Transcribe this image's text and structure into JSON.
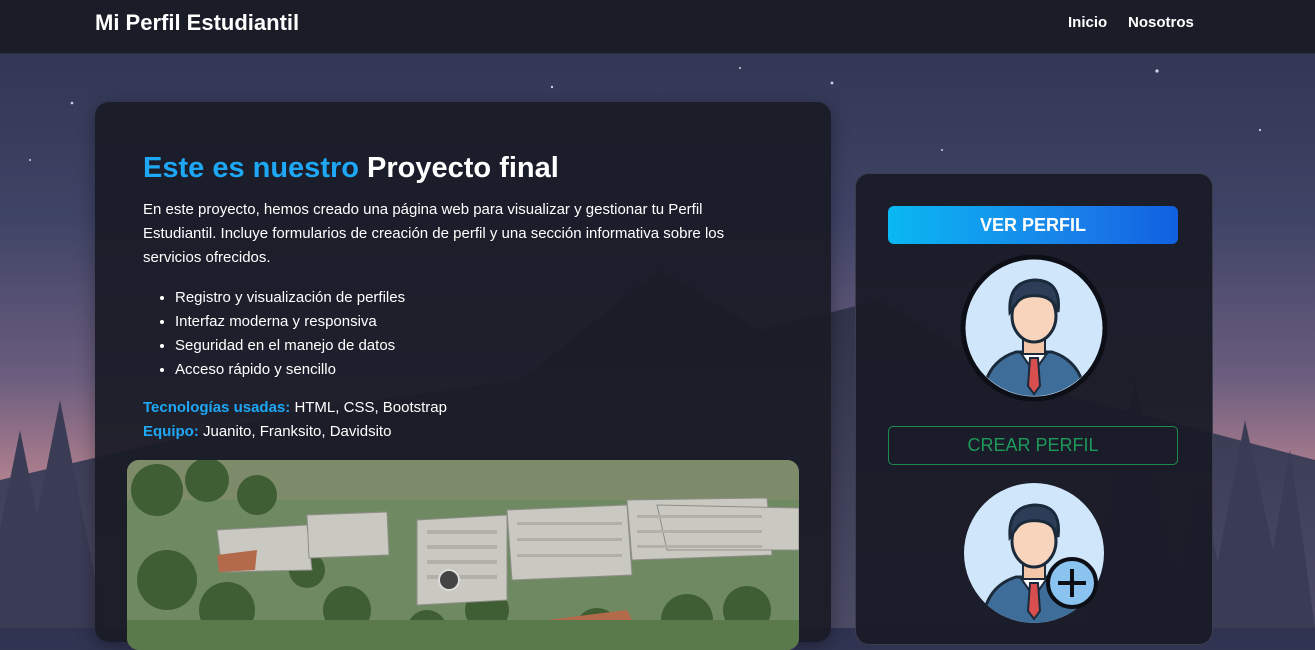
{
  "navbar": {
    "brand": "Mi Perfil Estudiantil",
    "links": [
      "Inicio",
      "Nosotros"
    ]
  },
  "hero": {
    "title_accent": "Este es nuestro",
    "title_main": "Proyecto final",
    "description": "En este proyecto, hemos creado una página web para visualizar y gestionar tu Perfil Estudiantil. Incluye formularios de creación de perfil y una sección informativa sobre los servicios ofrecidos.",
    "features": [
      "Registro y visualización de perfiles",
      "Interfaz moderna y responsiva",
      "Seguridad en el manejo de datos",
      "Acceso rápido y sencillo"
    ],
    "tech_label": "Tecnologías usadas:",
    "tech_value": "HTML, CSS, Bootstrap",
    "team_label": "Equipo:",
    "team_value": "Juanito, Franksito, Davidsito"
  },
  "sidebar": {
    "view_button": "VER PERFIL",
    "create_button": "CREAR PERFIL"
  },
  "icons": {
    "profile": "user-suit-icon",
    "create": "user-add-icon"
  },
  "colors": {
    "accent": "#1ea7f5",
    "success": "#1d9a5a",
    "card_bg": "#191b26",
    "navbar_bg": "#1a1c27"
  }
}
